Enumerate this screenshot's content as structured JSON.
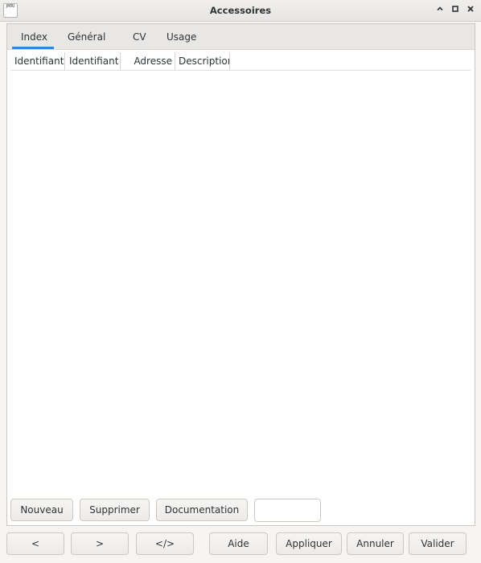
{
  "window": {
    "title": "Accessoires",
    "icon_text": "JMRI",
    "controls": [
      "minimize-icon",
      "maximize-icon",
      "close-icon"
    ]
  },
  "tabs": [
    {
      "label": "Index",
      "active": true
    },
    {
      "label": "Général",
      "active": false
    },
    {
      "label": "CV",
      "active": false
    },
    {
      "label": "Usage",
      "active": false
    }
  ],
  "table": {
    "columns": [
      "Identifiant",
      "Identifiant (",
      "Adresse",
      "Description"
    ],
    "rows": []
  },
  "actions": {
    "new": "Nouveau",
    "delete": "Supprimer",
    "documentation": "Documentation",
    "input_value": ""
  },
  "footer": {
    "prev": "<",
    "next": ">",
    "code": "</>",
    "help": "Aide",
    "apply": "Appliquer",
    "cancel": "Annuler",
    "ok": "Valider"
  },
  "colors": {
    "accent": "#3584e4",
    "background": "#f6f5f4",
    "panel": "#ffffff"
  }
}
